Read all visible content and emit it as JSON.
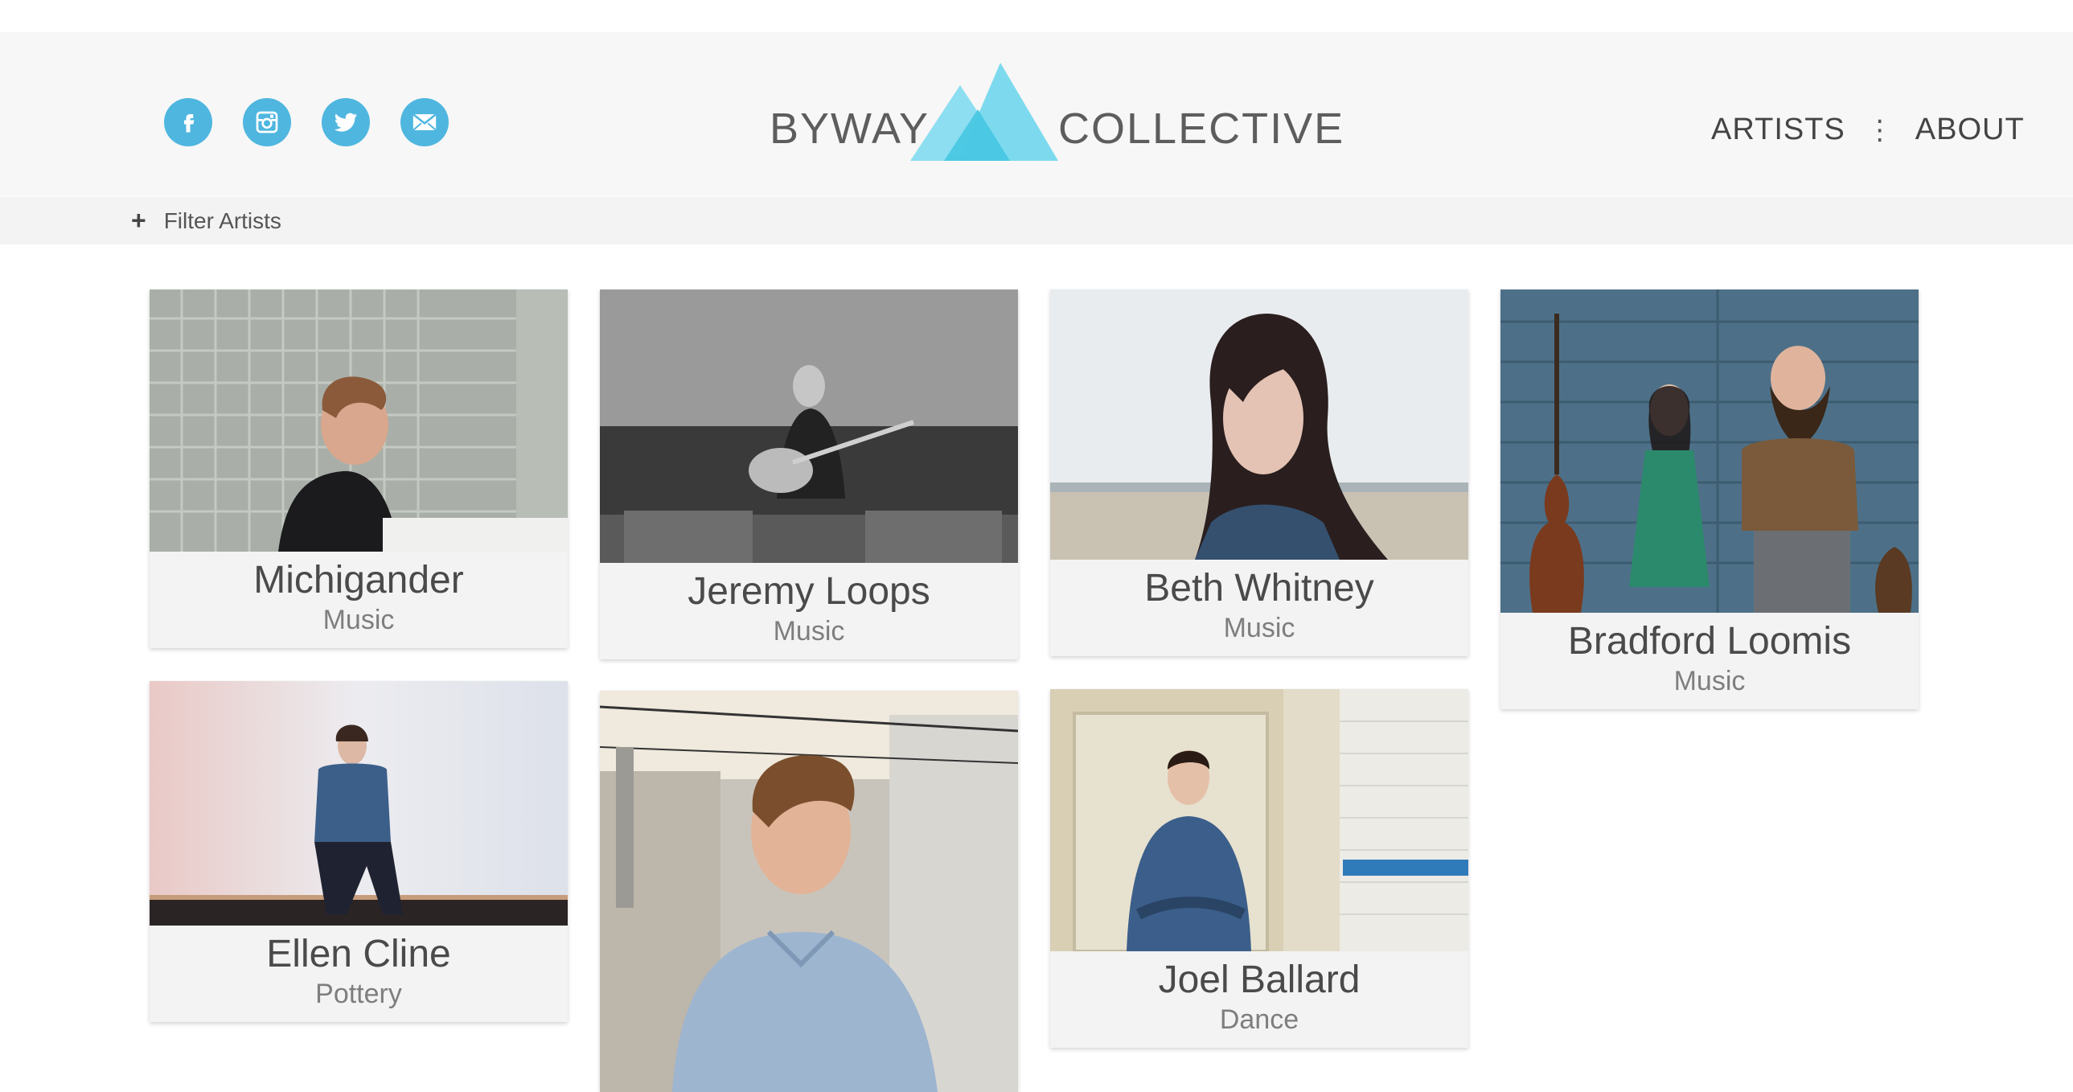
{
  "brand": {
    "left": "BYWAY",
    "right": "COLLECTIVE",
    "colors": {
      "accent": "#4fb6df",
      "mountain_light": "#7fdbef",
      "mountain_mid": "#5fcfe8",
      "mountain_dark": "#3ec2de"
    }
  },
  "social": {
    "icons": [
      "facebook-icon",
      "instagram-icon",
      "twitter-icon",
      "mail-icon"
    ]
  },
  "nav": {
    "artists": "ARTISTS",
    "separator": "⋮",
    "about": "ABOUT"
  },
  "filter": {
    "icon": "+",
    "label": "Filter Artists"
  },
  "artists": [
    {
      "name": "Michigander",
      "category": "Music"
    },
    {
      "name": "Jeremy Loops",
      "category": "Music"
    },
    {
      "name": "Beth Whitney",
      "category": "Music"
    },
    {
      "name": "Bradford Loomis",
      "category": "Music"
    },
    {
      "name": "Ellen Cline",
      "category": "Pottery"
    },
    {
      "name": "Joel Ballard",
      "category": "Dance"
    }
  ]
}
